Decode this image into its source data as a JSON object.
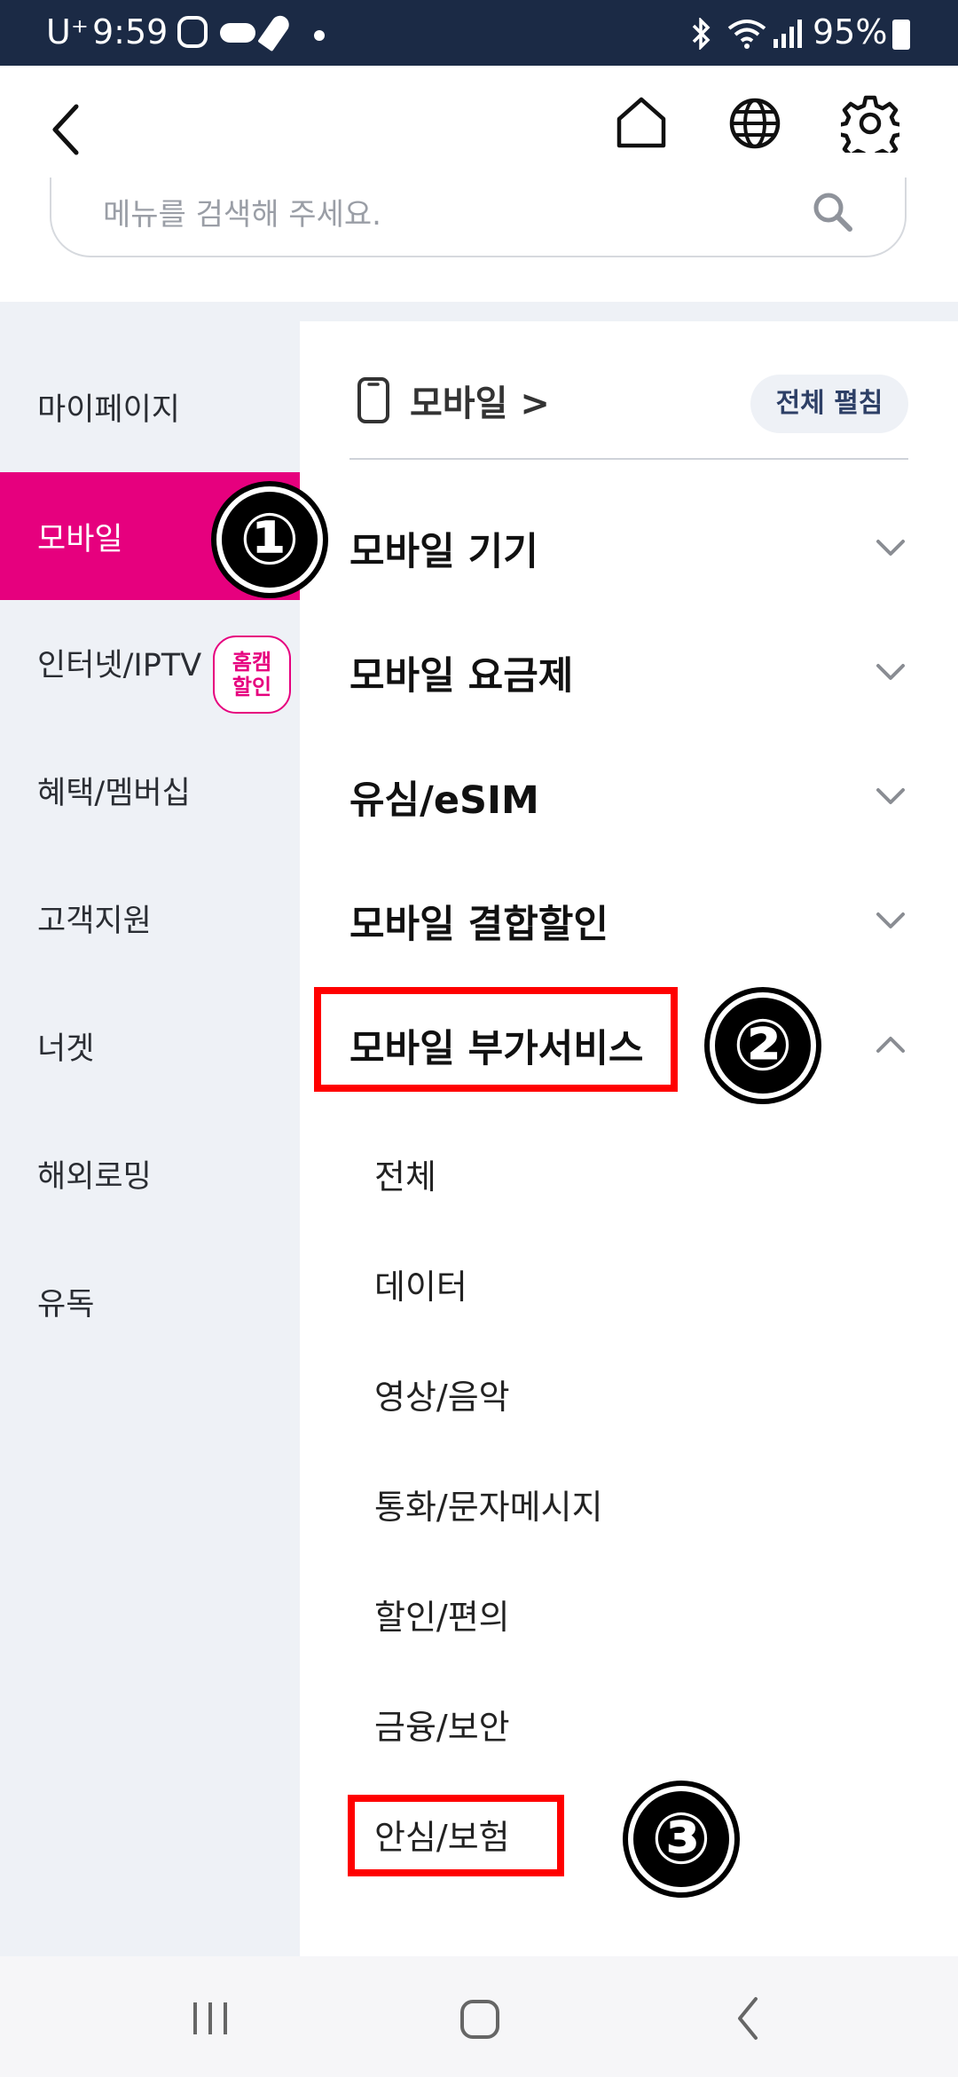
{
  "status_bar": {
    "carrier": "U⁺",
    "time": "9:59",
    "battery": "95%"
  },
  "header": {
    "back_icon": "chevron-left-icon",
    "home_icon": "home-icon",
    "globe_icon": "globe-icon",
    "settings_icon": "gear-icon"
  },
  "search": {
    "placeholder": "메뉴를 검색해 주세요.",
    "icon": "search-icon"
  },
  "sidebar": {
    "items": [
      {
        "label": "마이페이지"
      },
      {
        "label": "모바일",
        "active": true
      },
      {
        "label": "인터넷/IPTV",
        "badge": "홈캠\n할인"
      },
      {
        "label": "혜택/멤버십"
      },
      {
        "label": "고객지원"
      },
      {
        "label": "너겟"
      },
      {
        "label": "해외로밍"
      },
      {
        "label": "유독"
      }
    ]
  },
  "main": {
    "breadcrumb": "모바일 >",
    "expand_all": "전체 펼침",
    "categories": [
      {
        "label": "모바일 기기",
        "expanded": false
      },
      {
        "label": "모바일 요금제",
        "expanded": false
      },
      {
        "label": "유심/eSIM",
        "expanded": false
      },
      {
        "label": "모바일 결합할인",
        "expanded": false
      },
      {
        "label": "모바일 부가서비스",
        "expanded": true
      }
    ],
    "subitems": [
      "전체",
      "데이터",
      "영상/음악",
      "통화/문자메시지",
      "할인/편의",
      "금융/보안",
      "안심/보험"
    ]
  },
  "annotations": {
    "marker1": "①",
    "marker2": "②",
    "marker3": "③",
    "box_color": "#ff0000"
  },
  "colors": {
    "accent": "#e6007e",
    "status_bar": "#1b2a45",
    "sidebar_bg": "#eef1f6"
  }
}
